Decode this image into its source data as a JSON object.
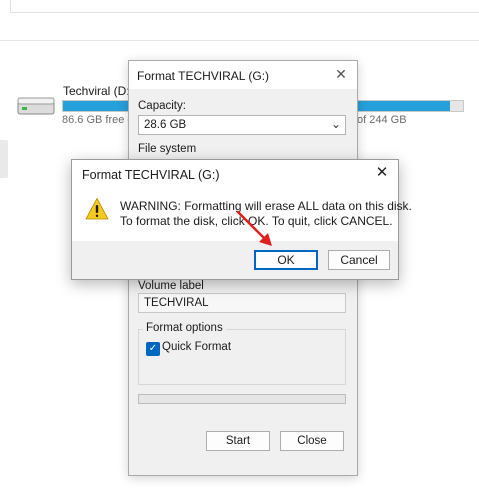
{
  "explorer": {
    "drive1": {
      "name": "Techviral (D:)",
      "free_text": "86.6 GB free o",
      "usage_fraction": 1.0
    },
    "drive2": {
      "label_tail": ")",
      "free_text": "of 244 GB",
      "usage_fraction": 0.88
    },
    "accent_color": "#26a0da"
  },
  "format_dialog": {
    "title": "Format TECHVIRAL (G:)",
    "close_icon": "close-icon",
    "capacity_label": "Capacity:",
    "capacity_value": "28.6 GB",
    "file_system_label": "File system",
    "volume_label_label": "Volume label",
    "volume_label_value": "TECHVIRAL",
    "format_options_label": "Format options",
    "quick_format_label": "Quick Format",
    "quick_format_checked": true,
    "start_label": "Start",
    "close_label": "Close"
  },
  "warning_dialog": {
    "title": "Format TECHVIRAL (G:)",
    "icon": "warning-icon",
    "line1": "WARNING: Formatting will erase ALL data on this disk.",
    "line2": "To format the disk, click OK. To quit, click CANCEL.",
    "ok_label": "OK",
    "cancel_label": "Cancel",
    "accent_color": "#0067c0"
  },
  "annotation": {
    "arrow_color": "#e0201f"
  }
}
